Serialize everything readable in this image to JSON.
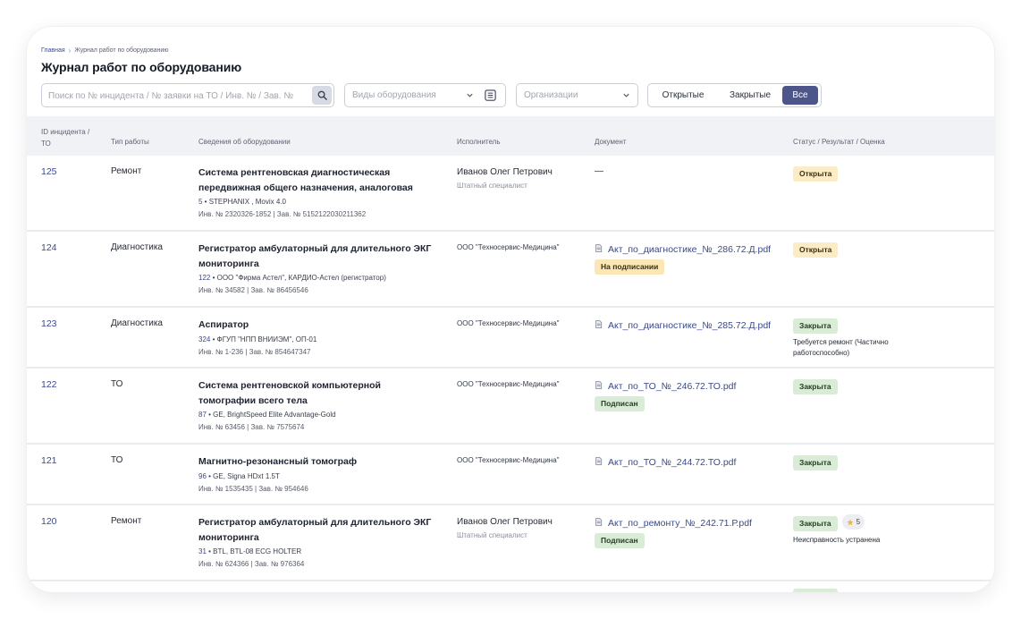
{
  "breadcrumb": {
    "home": "Главная",
    "separator": "›",
    "current": "Журнал работ по оборудованию"
  },
  "page": {
    "title": "Журнал работ по оборудованию"
  },
  "filters": {
    "search_placeholder": "Поиск по № инцидента / № заявки на ТО / Инв. № / Зав. №",
    "search_value": "",
    "equipment_placeholder": "Виды оборудования",
    "org_placeholder": "Организации",
    "segments": [
      "Открытые",
      "Закрытые",
      "Все"
    ],
    "active_segment": "Все"
  },
  "columns": {
    "id": "ID инцидента / ТО",
    "type": "Тип работы",
    "equipment": "Сведения об оборудовании",
    "executor": "Исполнитель",
    "document": "Документ",
    "status": "Статус / Результат / Оценка"
  },
  "rows": [
    {
      "id": "125",
      "type": "Ремонт",
      "eq_name": "Система рентгеновская диагностическая передвижная общего назначения, аналоговая",
      "eq_num": "5",
      "eq_maker": "STEPHANIX , Movix 4.0",
      "eq_inv": "Инв. № 2320326-1852  |  Зав. № 5152122030211362",
      "executor": "Иванов Олег Петрович",
      "role": "Штатный специалист",
      "doc": "",
      "doc_empty": "—",
      "doc_badge": "",
      "status": "Открыта",
      "status_kind": "open",
      "note": "",
      "rating": ""
    },
    {
      "id": "124",
      "type": "Диагностика",
      "eq_name": "Регистратор амбулаторный для длительного ЭКГ мониторинга",
      "eq_num": "122",
      "eq_maker": "ООО \"Фирма Астел\", КАРДИО-Астел (регистратор)",
      "eq_inv": "Инв. № 34582  |  Зав. № 86456546",
      "executor": "ООО \"Техносервис-Медицина\"",
      "role": "",
      "doc": "Акт_по_диагностике_№_286.72.Д.pdf",
      "doc_empty": "",
      "doc_badge": "На подписании",
      "status": "Открыта",
      "status_kind": "open",
      "note": "",
      "rating": ""
    },
    {
      "id": "123",
      "type": "Диагностика",
      "eq_name": "Аспиратор",
      "eq_num": "324",
      "eq_maker": "ФГУП \"НПП ВНИИЭМ\", ОП-01",
      "eq_inv": "Инв. № 1-236  |  Зав. № 854647347",
      "executor": "ООО \"Техносервис-Медицина\"",
      "role": "",
      "doc": "Акт_по_диагностике_№_285.72.Д.pdf",
      "doc_empty": "",
      "doc_badge": "",
      "status": "Закрыта",
      "status_kind": "closed",
      "note": "Требуется ремонт (Частично работоспособно)",
      "rating": ""
    },
    {
      "id": "122",
      "type": "ТО",
      "eq_name": "Система рентгеновской компьютерной томографии всего тела",
      "eq_num": "87",
      "eq_maker": "GE, BrightSpeed Elite Advantage-Gold",
      "eq_inv": "Инв. № 63456  |  Зав. № 7575674",
      "executor": "ООО \"Техносервис-Медицина\"",
      "role": "",
      "doc": "Акт_по_ТО_№_246.72.ТО.pdf",
      "doc_empty": "",
      "doc_badge": "Подписан",
      "status": "Закрыта",
      "status_kind": "closed",
      "note": "",
      "rating": ""
    },
    {
      "id": "121",
      "type": "ТО",
      "eq_name": "Магнитно-резонансный томограф",
      "eq_num": "96",
      "eq_maker": "GE, Signa HDxt 1.5T",
      "eq_inv": "Инв. № 1535435  |  Зав. № 954646",
      "executor": "ООО \"Техносервис-Медицина\"",
      "role": "",
      "doc": "Акт_по_ТО_№_244.72.ТО.pdf",
      "doc_empty": "",
      "doc_badge": "",
      "status": "Закрыта",
      "status_kind": "closed",
      "note": "",
      "rating": ""
    },
    {
      "id": "120",
      "type": "Ремонт",
      "eq_name": "Регистратор амбулаторный для длительного ЭКГ мониторинга",
      "eq_num": "31",
      "eq_maker": "BTL, BTL-08 ECG HOLTER",
      "eq_inv": "Инв. № 624366  |  Зав. № 976364",
      "executor": "Иванов Олег Петрович",
      "role": "Штатный специалист",
      "doc": "Акт_по_ремонту_№_242.71.Р.pdf",
      "doc_empty": "",
      "doc_badge": "Подписан",
      "status": "Закрыта",
      "status_kind": "closed",
      "note": "Неисправность устранена",
      "rating": "5"
    }
  ]
}
